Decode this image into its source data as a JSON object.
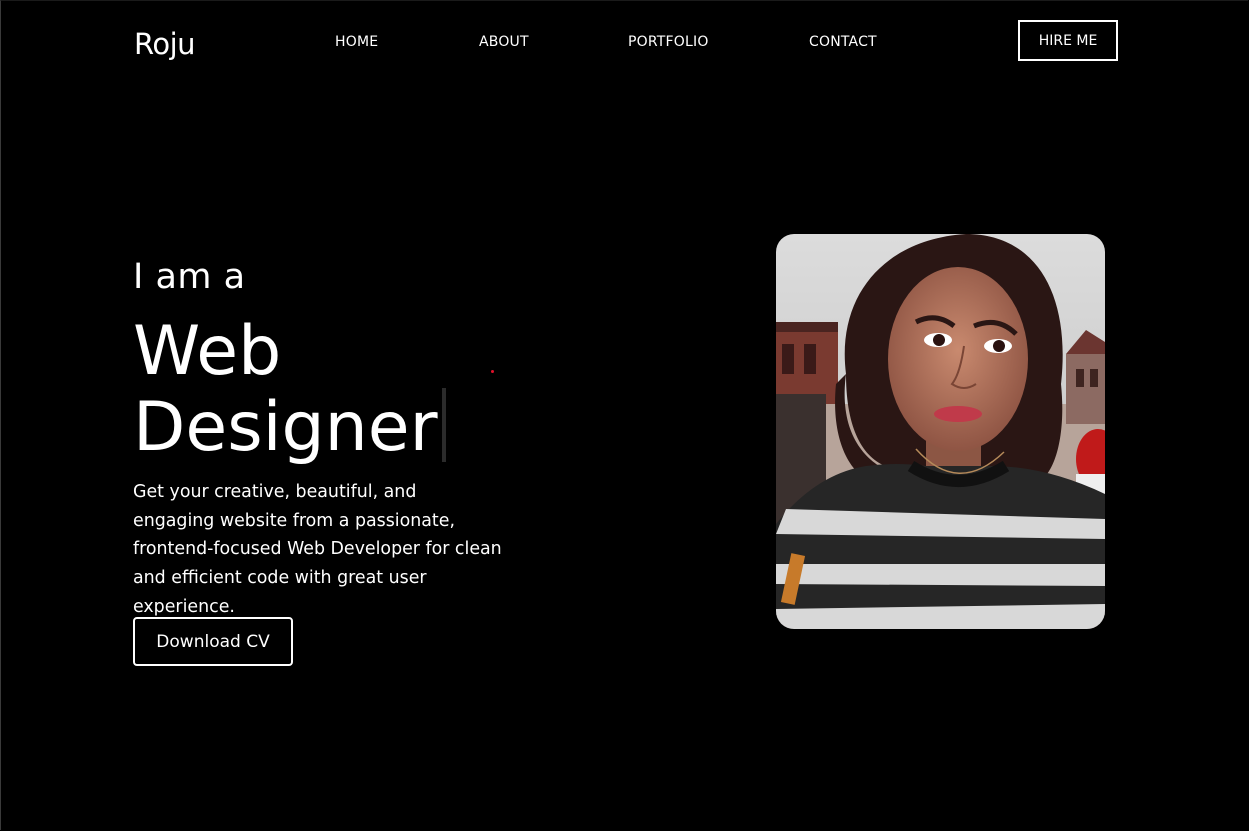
{
  "header": {
    "brand": "Roju",
    "nav": {
      "home": "HOME",
      "about": "ABOUT",
      "portfolio": "PORTFOLIO",
      "contact": "CONTACT"
    },
    "hire_label": "HIRE ME"
  },
  "hero": {
    "intro": "I am a",
    "role_line1": "Web",
    "role_line2": "Designer",
    "description": "Get your creative, beautiful, and engaging website from a passionate, frontend-focused Web Developer for clean and efficient code with great user experience.",
    "cv_label": "Download CV"
  },
  "colors": {
    "background": "#000000",
    "text": "#ffffff",
    "accent_dot": "#e0102a"
  }
}
